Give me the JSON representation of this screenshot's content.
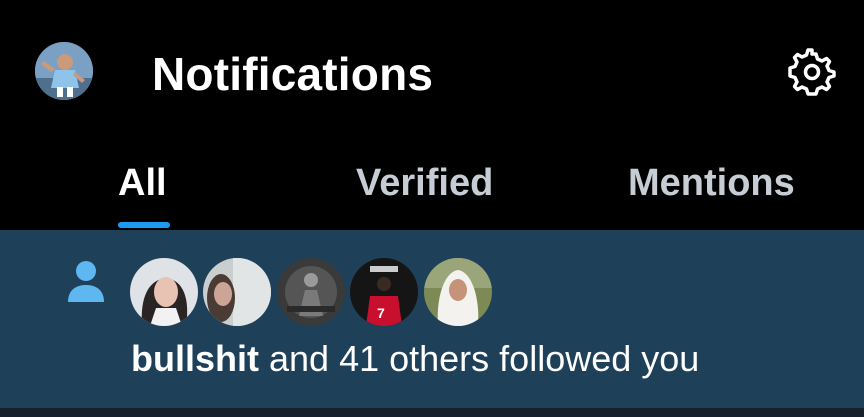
{
  "header": {
    "title": "Notifications",
    "avatar_icon": "user-avatar",
    "settings_icon": "gear-icon"
  },
  "tabs": [
    {
      "label": "All",
      "active": true
    },
    {
      "label": "Verified",
      "active": false
    },
    {
      "label": "Mentions",
      "active": false
    }
  ],
  "notification": {
    "type_icon": "person-icon",
    "follower_avatars": [
      "follower-avatar-1",
      "follower-avatar-2",
      "follower-avatar-3",
      "follower-avatar-4",
      "follower-avatar-5"
    ],
    "user_name": "bullshit",
    "message": " and 41 others followed you"
  },
  "colors": {
    "background": "#000000",
    "accent": "#1d9bf0",
    "notification_bg": "#1f4059",
    "inactive_tab": "#c7cdd4",
    "person_icon": "#5eb7ee"
  }
}
